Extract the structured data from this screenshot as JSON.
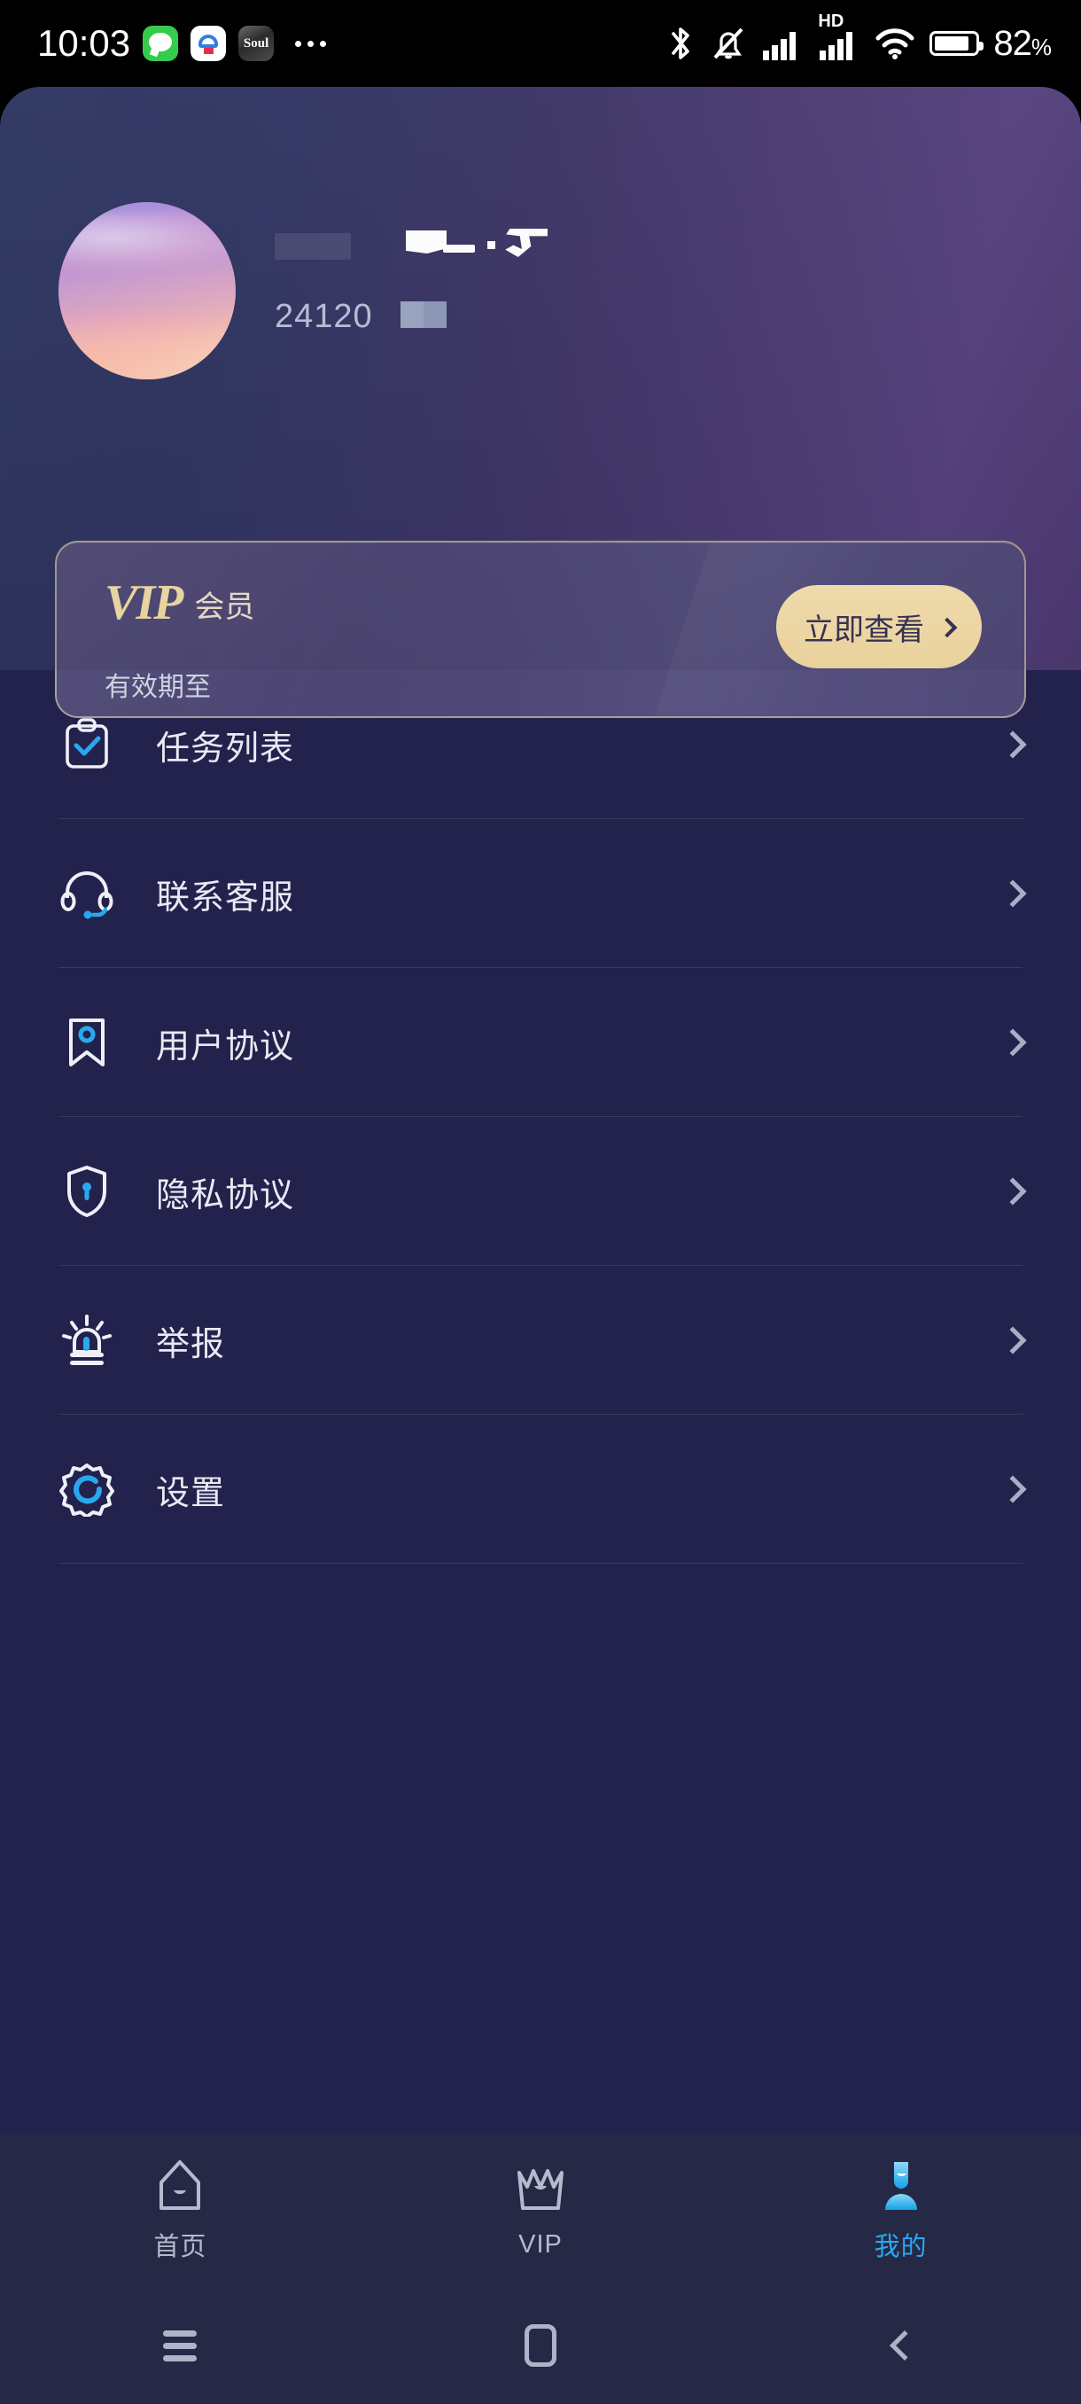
{
  "status_bar": {
    "time": "10:03",
    "app_icons": [
      "message-app-icon",
      "cloud-app-icon",
      "soul-app-icon"
    ],
    "soul_label": "Soul",
    "overflow": "...",
    "right_icons": [
      "bluetooth-icon",
      "mute-icon",
      "signal-icon",
      "hd-signal-icon",
      "wifi-icon",
      "battery-icon"
    ],
    "hd_label": "HD",
    "battery_percent": "82",
    "percent_symbol": "%"
  },
  "profile": {
    "avatar_alt": "user-avatar",
    "name_redacted": true,
    "user_id": "24120",
    "id_redacted": true
  },
  "vip_card": {
    "brand": "VIP",
    "brand_cn": "会员",
    "expiry_label": "有效期至",
    "expiry_value": "",
    "cta_label": "立即查看",
    "accent_color": "#f5dfa8",
    "card_bg": "#4f4877"
  },
  "menu": {
    "items": [
      {
        "label": "任务列表",
        "icon": "clipboard-check-icon"
      },
      {
        "label": "联系客服",
        "icon": "headset-icon"
      },
      {
        "label": "用户协议",
        "icon": "bookmark-icon"
      },
      {
        "label": "隐私协议",
        "icon": "shield-lock-icon"
      },
      {
        "label": "举报",
        "icon": "siren-alarm-icon"
      },
      {
        "label": "设置",
        "icon": "gear-icon"
      }
    ]
  },
  "tab_bar": {
    "active_index": 2,
    "active_color": "#2aa8ef",
    "inactive_color": "#b6bacd",
    "tabs": [
      {
        "label": "首页",
        "icon": "home-icon"
      },
      {
        "label": "VIP",
        "icon": "crown-icon"
      },
      {
        "label": "我的",
        "icon": "person-icon"
      }
    ]
  },
  "nav_bar": {
    "buttons": [
      {
        "name": "recents",
        "icon": "menu-lines-icon"
      },
      {
        "name": "home",
        "icon": "square-icon"
      },
      {
        "name": "back",
        "icon": "chevron-left-icon"
      }
    ]
  },
  "theme": {
    "page_bg": "#23224d",
    "header_start": "#2d3560",
    "header_end": "#55407d",
    "tabbar_bg": "#262945",
    "accent_blue": "#2aa8ef"
  }
}
